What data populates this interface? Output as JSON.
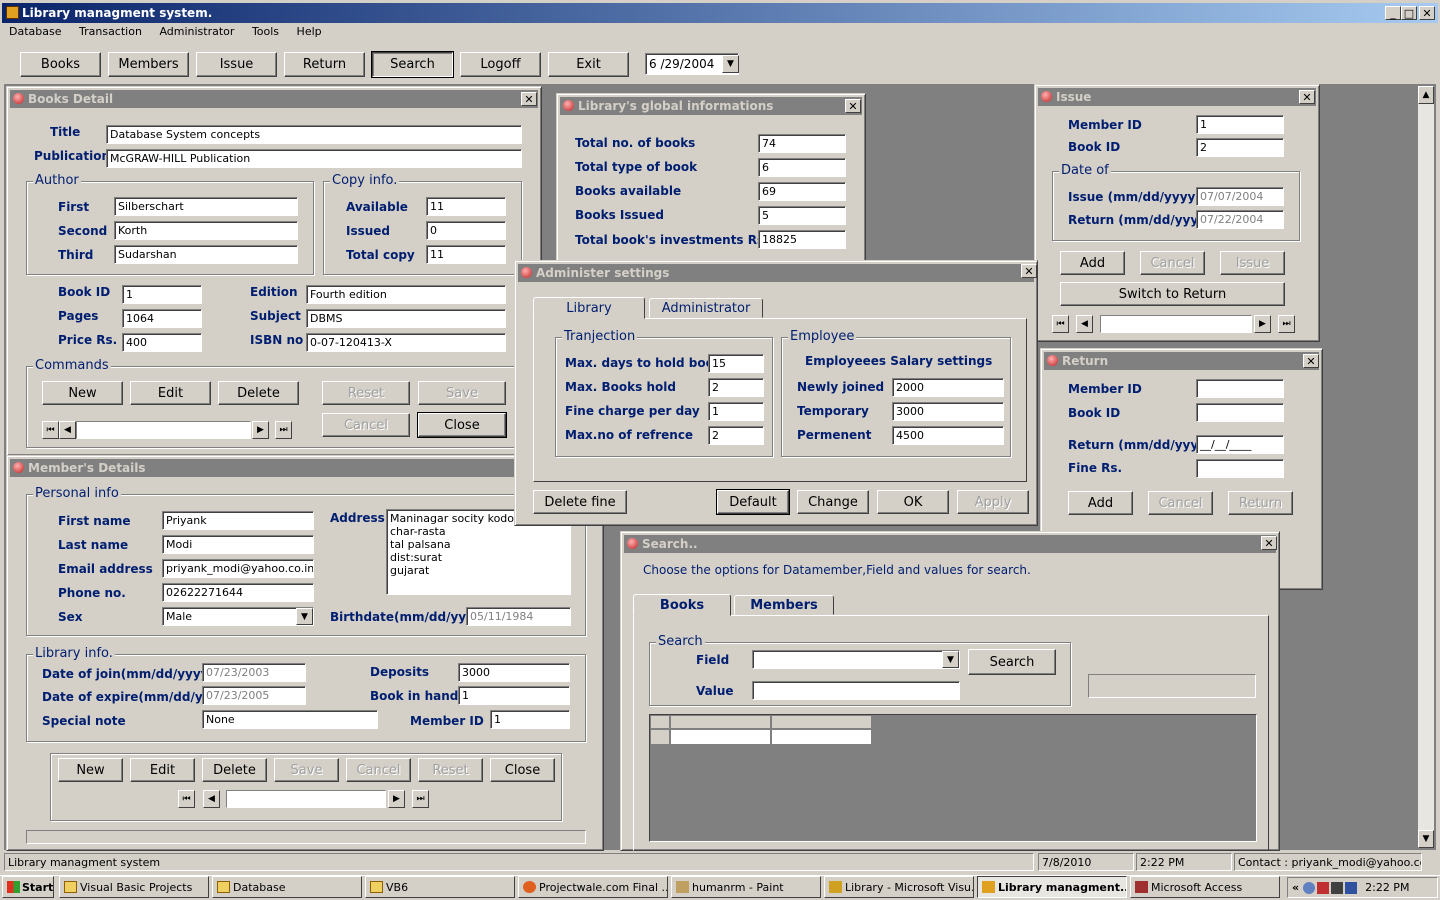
{
  "app": {
    "title": "Library managment system.",
    "menu": [
      "Database",
      "Transaction",
      "Administrator",
      "Tools",
      "Help"
    ],
    "toolbar": [
      "Books",
      "Members",
      "Issue",
      "Return",
      "Search",
      "Logoff",
      "Exit"
    ],
    "date": "6 /29/2004"
  },
  "books": {
    "title": "Books Detail",
    "title_label": "Title",
    "title_value": "Database System concepts",
    "publication_label": "Publication",
    "publication_value": "McGRAW-HILL Publication",
    "author_caption": "Author",
    "first_label": "First",
    "first": "Silberschart",
    "second_label": "Second",
    "second": "Korth",
    "third_label": "Third",
    "third": "Sudarshan",
    "copy_caption": "Copy info.",
    "available_label": "Available",
    "available": "11",
    "issued_label": "Issued",
    "issued": "0",
    "total_label": "Total copy",
    "total": "11",
    "bookid_label": "Book ID",
    "bookid": "1",
    "pages_label": "Pages",
    "pages": "1064",
    "price_label": "Price Rs.",
    "price": "400",
    "edition_label": "Edition",
    "edition": "Fourth edition",
    "subject_label": "Subject",
    "subject": "DBMS",
    "isbn_label": "ISBN no",
    "isbn": "0-07-120413-X",
    "commands_caption": "Commands",
    "new": "New",
    "edit": "Edit",
    "delete": "Delete",
    "reset": "Reset",
    "save": "Save",
    "cancel": "Cancel",
    "close": "Close"
  },
  "global": {
    "title": "Library's global informations",
    "total_books_label": "Total no. of books",
    "total_books": "74",
    "total_type_label": "Total type of book",
    "total_type": "6",
    "available_label": "Books available",
    "available": "69",
    "issued_label": "Books Issued",
    "issued": "5",
    "invest_label": "Total book's investments Rs.",
    "invest": "18825"
  },
  "issue": {
    "title": "Issue",
    "member_label": "Member ID",
    "member": "1",
    "book_label": "Book ID",
    "book": "2",
    "date_caption": "Date of",
    "issue_label": "Issue (mm/dd/yyyy)",
    "issue_date": "07/07/2004",
    "return_label": "Return (mm/dd/yyyy)",
    "return_date": "07/22/2004",
    "add": "Add",
    "cancel": "Cancel",
    "issue_btn": "Issue",
    "switch": "Switch to Return"
  },
  "return": {
    "title": "Return",
    "member_label": "Member ID",
    "book_label": "Book ID",
    "return_label": "Return (mm/dd/yyyy)",
    "return_mask": "__/__/____",
    "fine_label": "Fine Rs.",
    "add": "Add",
    "cancel": "Cancel",
    "return_btn": "Return"
  },
  "admin": {
    "title": "Administer settings",
    "tab_library": "Library",
    "tab_admin": "Administrator",
    "tranj_caption": "Tranjection",
    "maxdays_label": "Max. days to hold book",
    "maxdays": "15",
    "maxbooks_label": "Max. Books hold",
    "maxbooks": "2",
    "fine_label": "Fine charge per day",
    "fine": "1",
    "maxref_label": "Max.no of refrence",
    "maxref": "2",
    "emp_caption": "Employee",
    "salary_label": "Employeees Salary settings",
    "new_label": "Newly joined",
    "new": "2000",
    "temp_label": "Temporary",
    "temp": "3000",
    "perm_label": "Permenent",
    "perm": "4500",
    "delete_fine": "Delete fine",
    "default": "Default",
    "change": "Change",
    "ok": "OK",
    "apply": "Apply"
  },
  "members": {
    "title": "Member's Details",
    "personal_caption": "Personal info",
    "first_label": "First name",
    "first": "Priyank",
    "last_label": "Last name",
    "last": "Modi",
    "email_label": "Email address",
    "email": "priyank_modi@yahoo.co.in",
    "phone_label": "Phone no.",
    "phone": "02622271644",
    "sex_label": "Sex",
    "sex": "Male",
    "address_label": "Address",
    "address": [
      "Maninagar socity kodod",
      "char-rasta",
      "tal palsana",
      "dist:surat",
      "gujarat"
    ],
    "birth_label": "Birthdate(mm/dd/yyyy)",
    "birth": "05/11/1984",
    "lib_caption": "Library info.",
    "join_label": "Date of join(mm/dd/yyyy)",
    "join": "07/23/2003",
    "expire_label": "Date of expire(mm/dd/yyyy)",
    "expire": "07/23/2005",
    "note_label": "Special note",
    "note": "None",
    "deposits_label": "Deposits",
    "deposits": "3000",
    "inhand_label": "Book in hand",
    "inhand": "1",
    "memberid_label": "Member ID",
    "memberid": "1",
    "new": "New",
    "edit": "Edit",
    "delete": "Delete",
    "save": "Save",
    "cancel": "Cancel",
    "reset": "Reset",
    "close": "Close"
  },
  "search": {
    "title": "Search..",
    "instruction": "Choose the options for Datamember,Field and values for search.",
    "tab_books": "Books",
    "tab_members": "Members",
    "search_caption": "Search",
    "field_label": "Field",
    "value_label": "Value",
    "search_btn": "Search"
  },
  "status": {
    "text": "Library managment system",
    "date": "7/8/2010",
    "time": "2:22 PM",
    "contact": "Contact : priyank_modi@yahoo.co.in"
  },
  "taskbar": {
    "start": "Start",
    "items": [
      "Visual Basic Projects",
      "Database",
      "VB6",
      "Projectwale.com Final ...",
      "humanrm - Paint",
      "Library - Microsoft Visu...",
      "Library managment...",
      "Microsoft Access"
    ],
    "clock": "2:22 PM"
  }
}
